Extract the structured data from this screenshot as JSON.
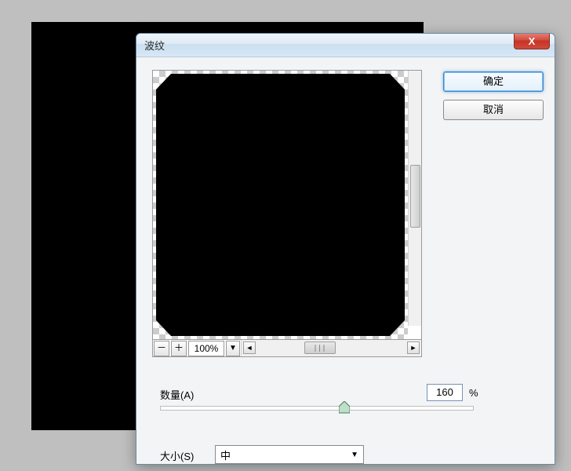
{
  "dialog": {
    "title": "波纹",
    "close_glyph": "X"
  },
  "buttons": {
    "ok": "确定",
    "cancel": "取消"
  },
  "zoom": {
    "minus": "－",
    "plus": "＋",
    "value": "100%",
    "caret": "▼"
  },
  "hscroll": {
    "left": "◄",
    "right": "►",
    "grip": "∣∣∣"
  },
  "amount": {
    "label": "数量(A)",
    "value": "160",
    "suffix": "%"
  },
  "size": {
    "label": "大小(S)",
    "selected": "中",
    "caret": "▼"
  }
}
